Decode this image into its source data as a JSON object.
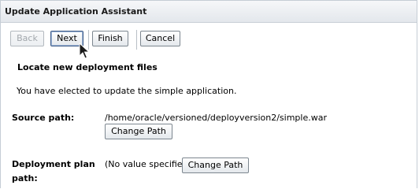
{
  "window": {
    "title": "Update Application Assistant"
  },
  "toolbar": {
    "back_label": "Back",
    "next_label": "Next",
    "finish_label": "Finish",
    "cancel_label": "Cancel"
  },
  "main": {
    "heading": "Locate new deployment files",
    "intro": "You have elected to update the simple application.",
    "source_path_label": "Source path:",
    "source_path_value": "/home/oracle/versioned/deployversion2/simple.war",
    "change_source_path_label": "Change Path",
    "deployment_plan_label_line1": "Deployment plan",
    "deployment_plan_label_line2": "path:",
    "deployment_plan_value": "(No value specified)",
    "change_plan_path_label": "Change Path"
  },
  "icons": {
    "cursor": "mouse-pointer-icon"
  }
}
